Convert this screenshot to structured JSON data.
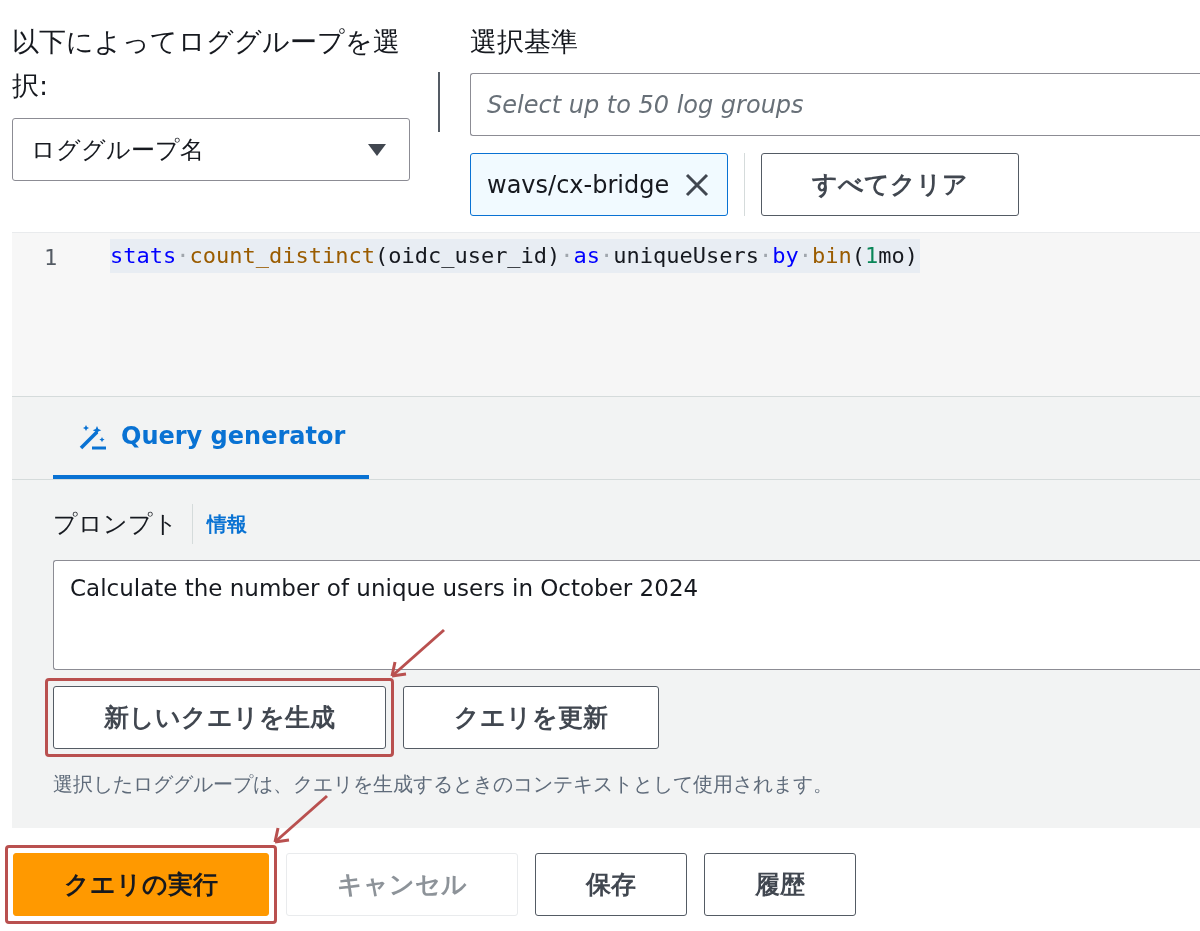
{
  "log_group_selector": {
    "label": "以下によってロググループを選択:",
    "dropdown": {
      "value": "ロググループ名"
    }
  },
  "selection_criteria": {
    "label": "選択基準",
    "search": {
      "placeholder": "Select up to 50 log groups"
    },
    "tokens": [
      {
        "label": "wavs/cx-bridge"
      }
    ],
    "clear_button": {
      "label": "すべてクリア"
    }
  },
  "editor": {
    "lines": [
      {
        "number": "1",
        "tokens": [
          {
            "kind": "keyword",
            "text": "stats"
          },
          {
            "kind": "space",
            "text": "·"
          },
          {
            "kind": "function",
            "text": "count_distinct"
          },
          {
            "kind": "plain",
            "text": "(oidc_user_id)"
          },
          {
            "kind": "space",
            "text": "·"
          },
          {
            "kind": "keyword",
            "text": "as"
          },
          {
            "kind": "space",
            "text": "·"
          },
          {
            "kind": "plain",
            "text": "uniqueUsers"
          },
          {
            "kind": "space",
            "text": "·"
          },
          {
            "kind": "keyword",
            "text": "by"
          },
          {
            "kind": "space",
            "text": "·"
          },
          {
            "kind": "function",
            "text": "bin"
          },
          {
            "kind": "plain",
            "text": "("
          },
          {
            "kind": "number",
            "text": "1"
          },
          {
            "kind": "plain",
            "text": "mo)"
          }
        ]
      }
    ]
  },
  "query_generator": {
    "tabs": [
      {
        "label": "Query generator",
        "selected": true
      }
    ],
    "prompt_label": "プロンプト",
    "info_link": "情報",
    "prompt_value": "Calculate the number of unique users in October 2024",
    "buttons": [
      {
        "label": "新しいクエリを生成",
        "highlighted": true
      },
      {
        "label": "クエリを更新",
        "highlighted": false
      }
    ],
    "help_text": "選択したロググループは、クエリを生成するときのコンテキストとして使用されます。"
  },
  "actions": [
    {
      "label": "クエリの実行",
      "kind": "primary",
      "disabled": false,
      "highlighted": true
    },
    {
      "label": "キャンセル",
      "kind": "normal",
      "disabled": true,
      "highlighted": false
    },
    {
      "label": "保存",
      "kind": "normal",
      "disabled": false,
      "highlighted": false
    },
    {
      "label": "履歴",
      "kind": "normal",
      "disabled": false,
      "highlighted": false
    }
  ]
}
